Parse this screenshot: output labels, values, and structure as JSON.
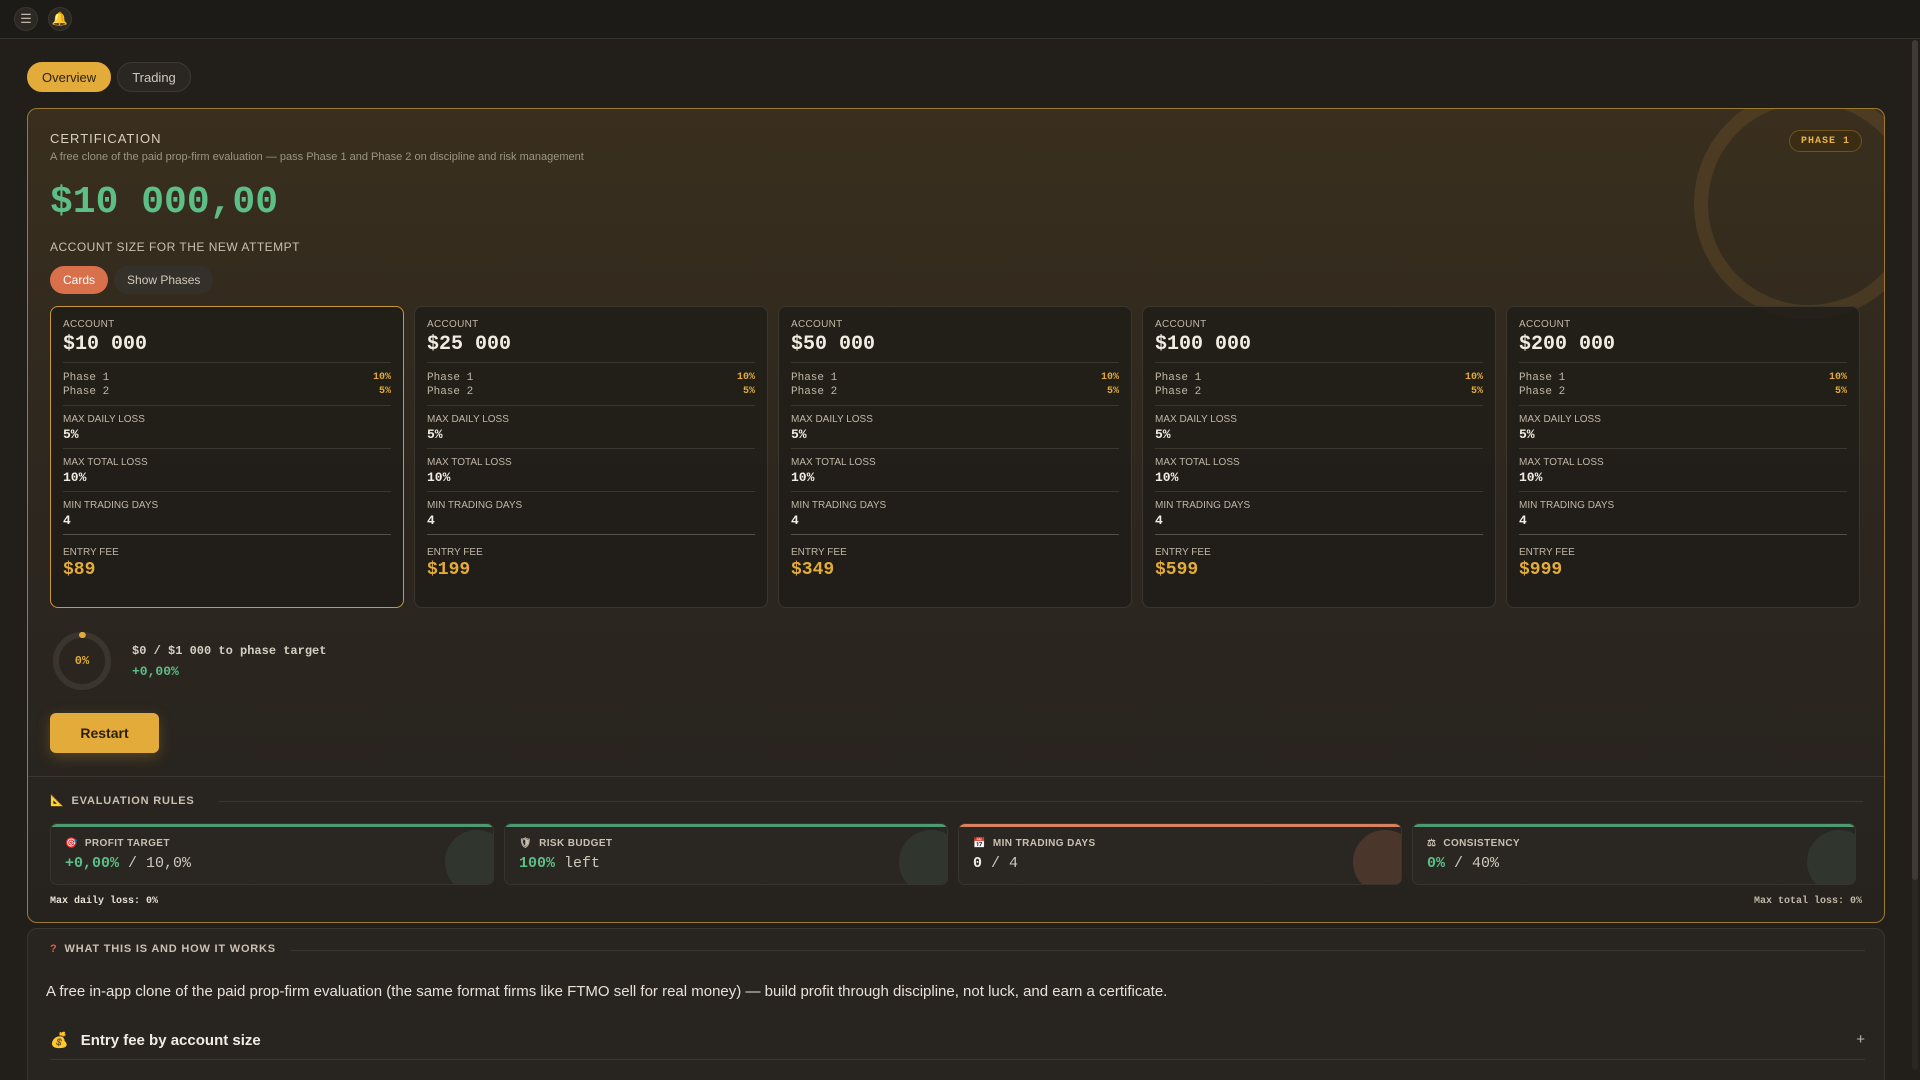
{
  "topbar": {
    "menu_icon": "☰",
    "bell_icon": "🔔"
  },
  "tabs": [
    {
      "label": "Overview",
      "active": true
    },
    {
      "label": "Trading",
      "active": false
    }
  ],
  "certification": {
    "title": "CERTIFICATION",
    "subtitle": "A free clone of the paid prop-firm evaluation — pass Phase 1 and Phase 2 on discipline and risk management",
    "phase_badge": "PHASE 1",
    "balance": "$10 000,00",
    "account_size_label": "ACCOUNT SIZE FOR THE NEW ATTEMPT",
    "view_toggle": [
      {
        "label": "Cards",
        "active": true
      },
      {
        "label": "Show Phases",
        "active": false
      }
    ]
  },
  "cards": [
    {
      "label": "ACCOUNT",
      "size": "$10 000",
      "phase1_label": "Phase 1",
      "phase1": "10%",
      "phase2_label": "Phase 2",
      "phase2": "5%",
      "daily_loss_label": "MAX DAILY LOSS",
      "daily_loss": "5%",
      "total_loss_label": "MAX TOTAL LOSS",
      "total_loss": "10%",
      "min_days_label": "MIN TRADING DAYS",
      "min_days": "4",
      "fee_label": "ENTRY FEE",
      "fee": "$89",
      "selected": true
    },
    {
      "label": "ACCOUNT",
      "size": "$25 000",
      "phase1_label": "Phase 1",
      "phase1": "10%",
      "phase2_label": "Phase 2",
      "phase2": "5%",
      "daily_loss_label": "MAX DAILY LOSS",
      "daily_loss": "5%",
      "total_loss_label": "MAX TOTAL LOSS",
      "total_loss": "10%",
      "min_days_label": "MIN TRADING DAYS",
      "min_days": "4",
      "fee_label": "ENTRY FEE",
      "fee": "$199",
      "selected": false
    },
    {
      "label": "ACCOUNT",
      "size": "$50 000",
      "phase1_label": "Phase 1",
      "phase1": "10%",
      "phase2_label": "Phase 2",
      "phase2": "5%",
      "daily_loss_label": "MAX DAILY LOSS",
      "daily_loss": "5%",
      "total_loss_label": "MAX TOTAL LOSS",
      "total_loss": "10%",
      "min_days_label": "MIN TRADING DAYS",
      "min_days": "4",
      "fee_label": "ENTRY FEE",
      "fee": "$349",
      "selected": false
    },
    {
      "label": "ACCOUNT",
      "size": "$100 000",
      "phase1_label": "Phase 1",
      "phase1": "10%",
      "phase2_label": "Phase 2",
      "phase2": "5%",
      "daily_loss_label": "MAX DAILY LOSS",
      "daily_loss": "5%",
      "total_loss_label": "MAX TOTAL LOSS",
      "total_loss": "10%",
      "min_days_label": "MIN TRADING DAYS",
      "min_days": "4",
      "fee_label": "ENTRY FEE",
      "fee": "$599",
      "selected": false
    },
    {
      "label": "ACCOUNT",
      "size": "$200 000",
      "phase1_label": "Phase 1",
      "phase1": "10%",
      "phase2_label": "Phase 2",
      "phase2": "5%",
      "daily_loss_label": "MAX DAILY LOSS",
      "daily_loss": "5%",
      "total_loss_label": "MAX TOTAL LOSS",
      "total_loss": "10%",
      "min_days_label": "MIN TRADING DAYS",
      "min_days": "4",
      "fee_label": "ENTRY FEE",
      "fee": "$999",
      "selected": false
    }
  ],
  "progress": {
    "percent_label": "0%",
    "percent_value": 0,
    "target_text": "$0 / $1 000 to phase target",
    "pnl": "+0,00%"
  },
  "restart_label": "Restart",
  "rules": {
    "title": "EVALUATION RULES",
    "items": [
      {
        "title": "PROFIT TARGET",
        "value": "+0,00%",
        "rest": " / 10,0%",
        "icon": "🎯",
        "style": "ok"
      },
      {
        "title": "RISK BUDGET",
        "value": "100%",
        "rest": " left",
        "icon": "🛡",
        "style": "ok"
      },
      {
        "title": "MIN TRADING DAYS",
        "value": "0",
        "rest": " / 4",
        "icon": "📅",
        "style": "warn"
      },
      {
        "title": "CONSISTENCY",
        "value": "0%",
        "rest": " / 40%",
        "icon": "⚖",
        "style": "ok"
      }
    ],
    "max_daily_loss": "Max daily loss: 0%",
    "max_total_loss": "Max total loss: 0%"
  },
  "how": {
    "title": "WHAT THIS IS AND HOW IT WORKS",
    "text": "A free in-app clone of the paid prop-firm evaluation (the same format firms like FTMO sell for real money) — build profit through discipline, not luck, and earn a certificate.",
    "accordion": [
      {
        "icon": "💰",
        "label": "Entry fee by account size",
        "toggle": "+"
      }
    ]
  },
  "colors": {
    "accent": "#e3ac3a",
    "positive": "#5dbf86",
    "warn": "#d9805f",
    "toggle_active": "#d9704c"
  }
}
